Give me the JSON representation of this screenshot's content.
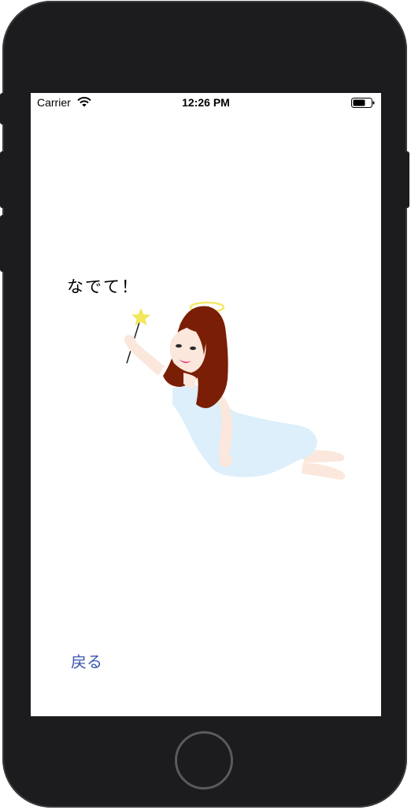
{
  "status_bar": {
    "carrier": "Carrier",
    "time": "12:26 PM",
    "wifi_icon": "wifi-icon",
    "battery_icon": "battery-icon"
  },
  "main": {
    "prompt": "なでて！",
    "illustration": "angel-fairy-illustration",
    "back_label": "戻る"
  },
  "colors": {
    "link": "#3b57b0",
    "dress": "#dceffa",
    "hair": "#7a1e05",
    "halo": "#f4e86a"
  }
}
